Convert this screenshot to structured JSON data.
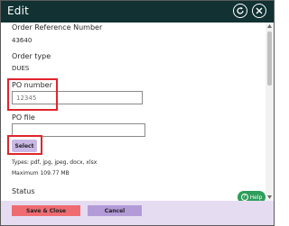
{
  "dialog": {
    "title": "Edit"
  },
  "fields": {
    "order_reference": {
      "label": "Order Reference Number",
      "value": "43640"
    },
    "order_type": {
      "label": "Order type",
      "value": "DUES"
    },
    "po_number": {
      "label": "PO number",
      "value": "12345",
      "placeholder": "12345"
    },
    "po_file": {
      "label": "PO file",
      "select_label": "Select",
      "types_text": "Types: pdf, jpg, jpeg, docx, xlsx",
      "max_text": "Maximum 109.77 MB"
    },
    "status": {
      "label": "Status"
    }
  },
  "help": {
    "label": "Help"
  },
  "footer": {
    "save_label": "Save & Close",
    "cancel_label": "Cancel"
  },
  "colors": {
    "titlebar": "#113133",
    "highlight": "#e0252d",
    "save": "#ef6b72",
    "cancel": "#b39bd8",
    "help": "#2e9e5b"
  }
}
